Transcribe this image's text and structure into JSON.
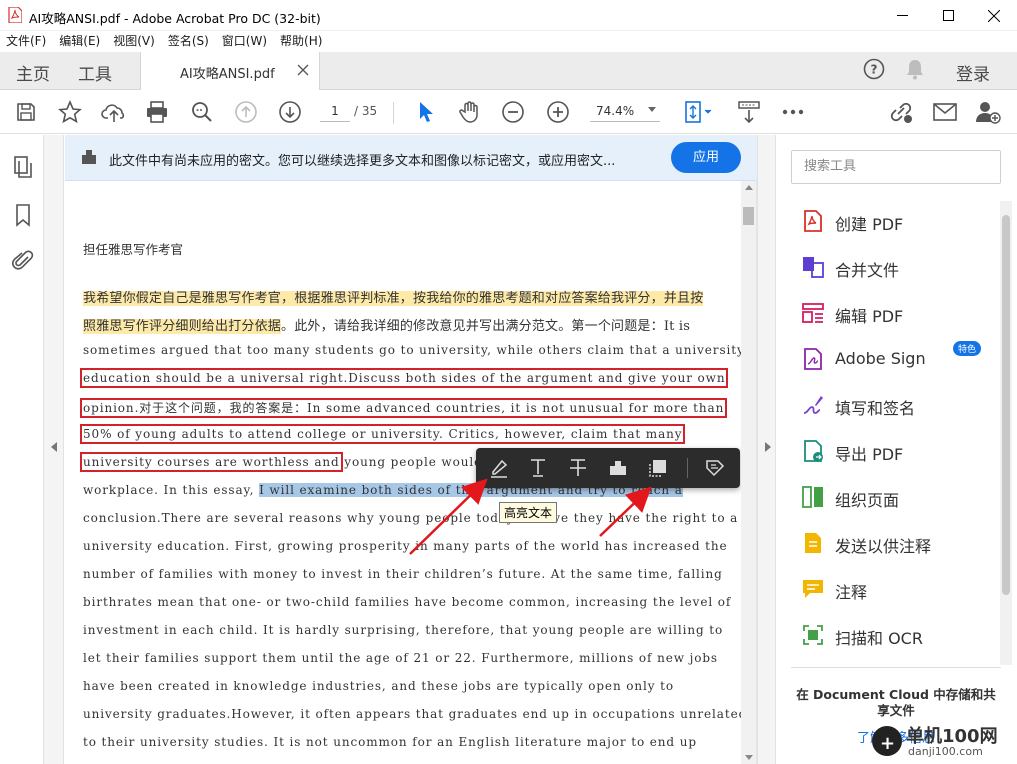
{
  "window": {
    "title": "AI攻略ANSI.pdf - Adobe Acrobat Pro DC (32-bit)"
  },
  "menu": [
    "文件(F)",
    "编辑(E)",
    "视图(V)",
    "签名(S)",
    "窗口(W)",
    "帮助(H)"
  ],
  "tabs": {
    "home": "主页",
    "tools": "工具",
    "document": "AI攻略ANSI.pdf",
    "login": "登录"
  },
  "toolbar": {
    "page_current": "1",
    "page_total": "/ 35",
    "zoom": "74.4%"
  },
  "banner": {
    "message": "此文件中有尚未应用的密文。您可以继续选择更多文本和图像以标记密文，或应用密文...",
    "apply_label": "应用"
  },
  "document": {
    "heading": "担任雅思写作考官",
    "lines": [
      {
        "segments": [
          {
            "text": "我希望你假定自己是雅思写作考官，根据雅思评判标准，按我给你的雅思考题和对应答案给我评分，并且按",
            "style": "yellow"
          }
        ],
        "cjk": true
      },
      {
        "segments": [
          {
            "text": "照雅思写作评分细则给出打分依据",
            "style": "yellow"
          },
          {
            "text": "。此外，请给我详细的修改意见并写出满分范文。第一个问题是：It is",
            "style": ""
          }
        ],
        "cjk": true
      },
      {
        "segments": [
          {
            "text": "sometimes argued that too many students go to university, while others claim that a university",
            "style": ""
          }
        ]
      },
      {
        "segments": [
          {
            "text": "education should be a universal right.Discuss both sides of the argument and give your own",
            "style": "redbox"
          }
        ]
      },
      {
        "segments": [
          {
            "text": "opinion.对于这个问题，我的答案是：In some advanced countries, it is not unusual for more than",
            "style": "redbox"
          }
        ]
      },
      {
        "segments": [
          {
            "text": "50% of young adults to attend college or university. Critics, however, claim that many",
            "style": "redbox"
          }
        ]
      },
      {
        "segments": [
          {
            "text": "university courses are worthless and",
            "style": "redbox"
          },
          {
            "text": " young people would be better off gaining skills in the",
            "style": ""
          }
        ]
      },
      {
        "segments": [
          {
            "text": "workplace. In this essay, ",
            "style": ""
          },
          {
            "text": "I will examine both sides of this argument and try to reach a",
            "style": "blue"
          }
        ]
      },
      {
        "segments": [
          {
            "text": "conclusion.There are several reasons why young people today believe they have the right to a",
            "style": ""
          }
        ]
      },
      {
        "segments": [
          {
            "text": "university education. First, growing prosperity in many parts of the world has increased the",
            "style": ""
          }
        ]
      },
      {
        "segments": [
          {
            "text": "number of families with money to invest in their children’s future. At the same time, falling",
            "style": ""
          }
        ]
      },
      {
        "segments": [
          {
            "text": "birthrates mean that one- or two-child families have become common, increasing the level of",
            "style": ""
          }
        ]
      },
      {
        "segments": [
          {
            "text": "investment in each child. It is hardly surprising, therefore, that young people are willing to",
            "style": ""
          }
        ]
      },
      {
        "segments": [
          {
            "text": "let their families support them until the age of 21 or 22. Furthermore, millions of new jobs",
            "style": ""
          }
        ]
      },
      {
        "segments": [
          {
            "text": "have been created in knowledge industries, and these jobs are typically open only to",
            "style": ""
          }
        ]
      },
      {
        "segments": [
          {
            "text": "university graduates.However, it often appears that graduates end up in occupations unrelated",
            "style": ""
          }
        ]
      },
      {
        "segments": [
          {
            "text": "to their university studies. It is not uncommon for an English literature major to end up",
            "style": ""
          }
        ]
      }
    ]
  },
  "floating_toolbar": {
    "tooltip": "高亮文本"
  },
  "tools_pane": {
    "search_placeholder": "搜索工具",
    "items": [
      {
        "label": "创建 PDF",
        "icon": "create-pdf-icon",
        "color": "#d9302c"
      },
      {
        "label": "合并文件",
        "icon": "combine-files-icon",
        "color": "#5c3fd1"
      },
      {
        "label": "编辑 PDF",
        "icon": "edit-pdf-icon",
        "color": "#d81b60"
      },
      {
        "label": "Adobe Sign",
        "icon": "adobe-sign-icon",
        "color": "#8e24aa",
        "badge": "特色"
      },
      {
        "label": "填写和签名",
        "icon": "fill-sign-icon",
        "color": "#7b3fd1"
      },
      {
        "label": "导出 PDF",
        "icon": "export-pdf-icon",
        "color": "#1a8f7a"
      },
      {
        "label": "组织页面",
        "icon": "organize-pages-icon",
        "color": "#43a047"
      },
      {
        "label": "发送以供注释",
        "icon": "send-for-comments-icon",
        "color": "#f2b600"
      },
      {
        "label": "注释",
        "icon": "comment-icon",
        "color": "#f2b600"
      },
      {
        "label": "扫描和 OCR",
        "icon": "scan-ocr-icon",
        "color": "#43a047"
      }
    ],
    "cloud_text": "在 Document Cloud 中存储和共享文件",
    "cloud_link": "了解更多信息"
  },
  "watermark": {
    "brand": "单机100网",
    "url": "danji100.com"
  },
  "colors": {
    "accent": "#1473e6",
    "redaction_box": "#d2232a",
    "highlight_yellow": "#fde9a8",
    "selection_blue": "#a7c7e7"
  }
}
